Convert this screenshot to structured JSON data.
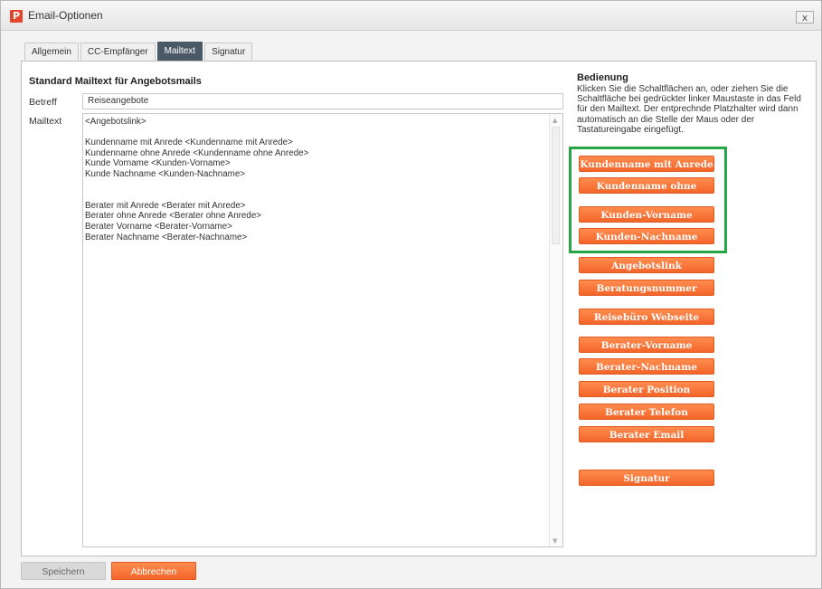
{
  "window": {
    "app_icon": "P",
    "title": "Email-Optionen",
    "close_label": "x"
  },
  "tabs": [
    {
      "label": "Allgemein"
    },
    {
      "label": "CC-Empfänger"
    },
    {
      "label": "Mailtext",
      "active": true
    },
    {
      "label": "Signatur"
    }
  ],
  "form": {
    "section_title": "Standard Mailtext für Angebotsmails",
    "subject_label": "Betreff",
    "subject_value": "Reiseangebote",
    "mailtext_label": "Mailtext",
    "mailtext_value": "<Angebotslink>\n\nKundenname mit Anrede <Kundenname mit Anrede>\nKundenname ohne Anrede <Kundenname ohne Anrede>\nKunde Vorname <Kunden-Vorname>\nKunde Nachname <Kunden-Nachname>\n\n\nBerater mit Anrede <Berater mit Anrede>\nBerater ohne Anrede <Berater ohne Anrede>\nBerater Vorname <Berater-Vorname>\nBerater Nachname <Berater-Nachname>"
  },
  "help": {
    "title": "Bedienung",
    "text": "Klicken Sie die Schaltflächen an, oder ziehen Sie die Schaltfläche bei gedrückter linker Maustaste in das Feld für den Mailtext. Der entprechnde Platzhalter wird dann automatisch an die Stelle der Maus oder der Tastatureingabe eingefügt."
  },
  "placeholder_buttons": [
    "Kundenname mit Anrede",
    "Kundenname ohne Anrede",
    "Kunden-Vorname",
    "Kunden-Nachname",
    "Angebotslink",
    "Beratungsnummer",
    "Reisebüro Webseite",
    "Berater-Vorname",
    "Berater-Nachname",
    "Berater Position",
    "Berater Telefon",
    "Berater Email",
    "Signatur"
  ],
  "footer": {
    "save_label": "Speichern",
    "cancel_label": "Abbrechen"
  },
  "colors": {
    "accent_orange": "#f4652a",
    "highlight_green": "#26a646",
    "tab_active": "#4b5967"
  }
}
